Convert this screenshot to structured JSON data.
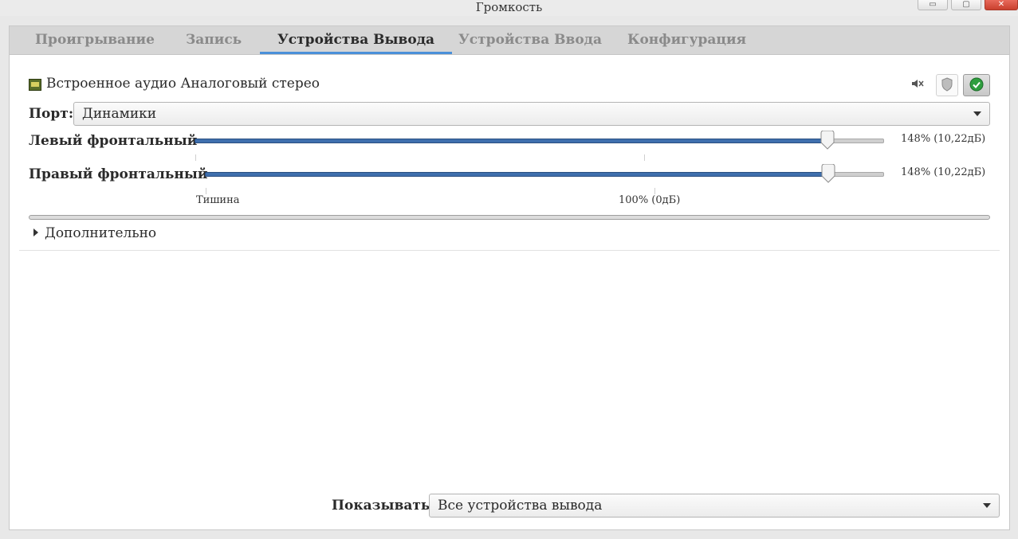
{
  "window": {
    "title": "Громкость",
    "buttons": [
      "▭",
      "▢",
      "✕"
    ]
  },
  "tabs": [
    {
      "label": "Проигрывание",
      "active": false
    },
    {
      "label": "Запись",
      "active": false
    },
    {
      "label": "Устройства Вывода",
      "active": true
    },
    {
      "label": "Устройства Ввода",
      "active": false
    },
    {
      "label": "Конфигурация",
      "active": false
    }
  ],
  "device": {
    "name": "Встроенное аудио Аналоговый стерео",
    "port_label": "Порт:",
    "port_value": "Динамики",
    "channels": [
      {
        "label": "Левый фронтальный",
        "value_text": "148% (10,22дБ)",
        "fraction": 0.92
      },
      {
        "label": "Правый фронтальный",
        "value_text": "148% (10,22дБ)",
        "fraction": 0.92
      }
    ],
    "marks": {
      "silence": "Тишина",
      "hundred": "100% (0дБ)"
    },
    "advanced_label": "Дополнительно"
  },
  "footer": {
    "show_label": "Показывать:",
    "show_value": "Все устройства вывода"
  },
  "colors": {
    "accent": "#4a90d9",
    "slider_fill": "#3f6fad",
    "default_check": "#2e9e3e"
  }
}
